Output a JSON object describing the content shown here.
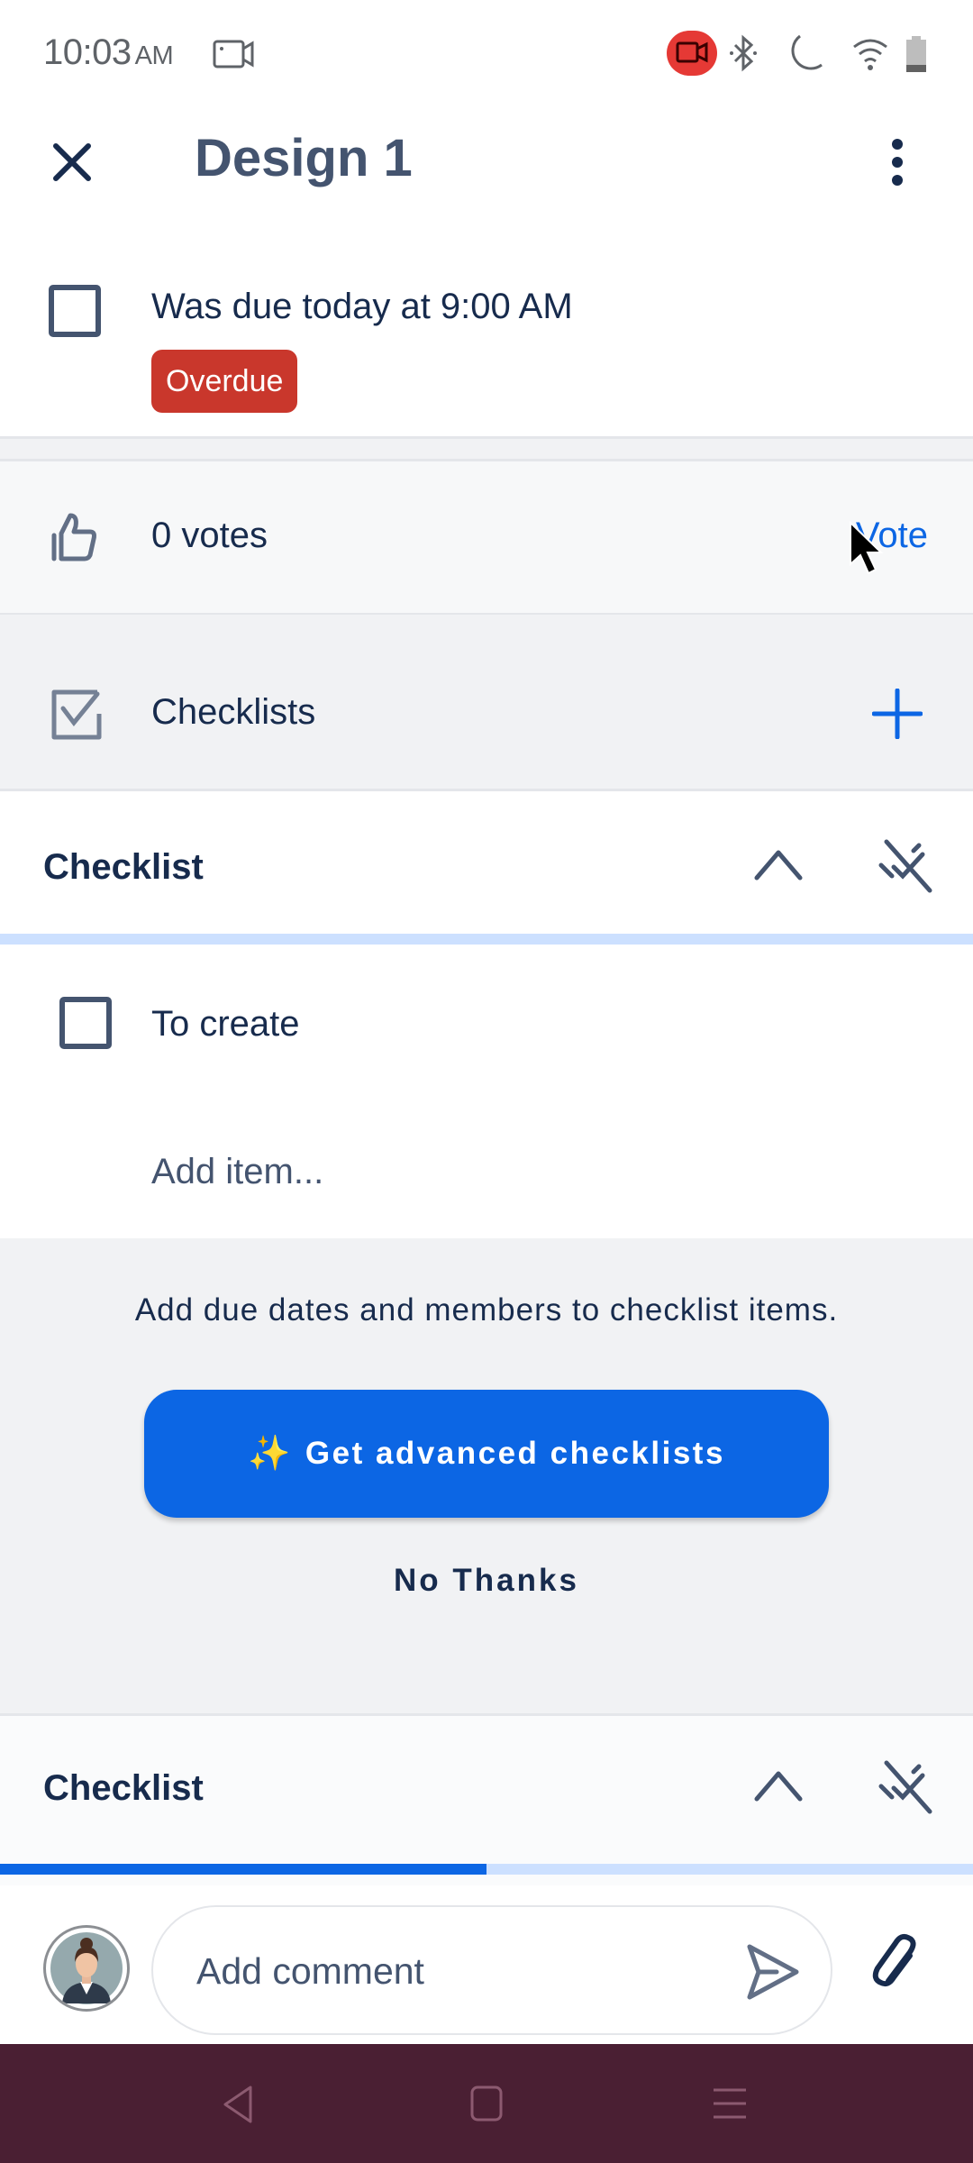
{
  "status_bar": {
    "time": "10:03",
    "ampm": "AM",
    "icons": [
      "screen-record-icon",
      "recording-badge-icon",
      "bluetooth-icon",
      "do-not-disturb-moon-icon",
      "wifi-icon",
      "battery-icon"
    ],
    "recording_color": "#e53935"
  },
  "header": {
    "title": "Design 1",
    "close_icon": "close-icon",
    "menu_icon": "more-vertical-icon"
  },
  "due": {
    "text": "Was due today at 9:00 AM",
    "badge": "Overdue",
    "badge_color": "#c9372c",
    "checked": false
  },
  "votes": {
    "label": "0 votes",
    "action": "Vote",
    "icon": "thumbs-up-icon"
  },
  "checklists_section": {
    "label": "Checklists",
    "icon": "checkbox-checked-icon",
    "add_icon": "plus-icon"
  },
  "checklists": [
    {
      "name": "Checklist",
      "progress_percent": 0,
      "items": [
        {
          "label": "To create",
          "checked": false
        }
      ],
      "add_item_placeholder": "Add item..."
    },
    {
      "name": "Checklist",
      "progress_percent": 50
    }
  ],
  "promo": {
    "text": "Add due dates and members to checklist items.",
    "cta_icon": "✨",
    "cta_label": "Get advanced checklists",
    "dismiss_label": "No Thanks"
  },
  "comment": {
    "placeholder": "Add comment",
    "send_icon": "send-icon",
    "attach_icon": "paperclip-icon"
  },
  "colors": {
    "accent": "#0c66e4",
    "progress_track": "#cce0ff",
    "nav_bar": "#4a1f33"
  }
}
